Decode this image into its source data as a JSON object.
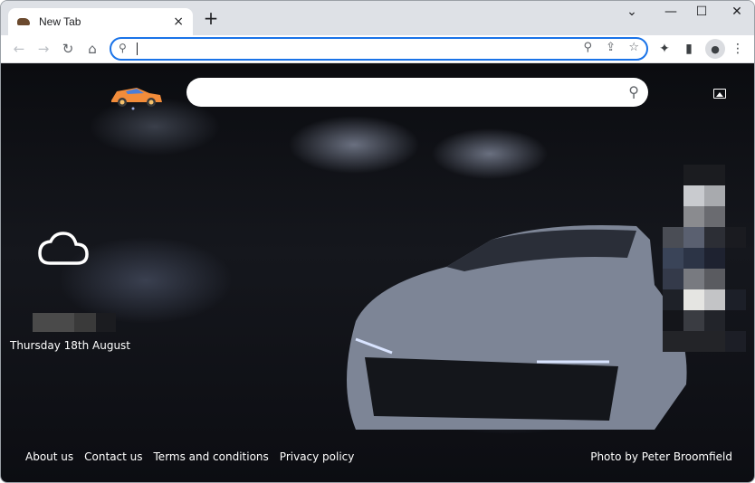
{
  "browser": {
    "tab": {
      "title": "New Tab",
      "close_icon": "×"
    },
    "new_tab_icon": "+",
    "window_controls": {
      "tab_search": "⌄",
      "minimize": "—",
      "maximize": "☐",
      "close": "✕"
    },
    "nav": {
      "back": "←",
      "forward": "→",
      "reload": "↻",
      "home": "⌂"
    },
    "omnibox": {
      "value": "",
      "search_icon": "🔍",
      "location_icon": "⚲",
      "share_icon": "⇪",
      "bookmark_icon": "☆"
    },
    "extensions_icon": "✦",
    "side_panel_icon": "▮",
    "profile_icon": "👤",
    "menu_icon": "⋮"
  },
  "page": {
    "search": {
      "value": "",
      "icon": "⌕"
    },
    "weather": {
      "condition": "cloudy",
      "temperature": ""
    },
    "date": "Thursday 18th August",
    "footer_links": [
      "About us",
      "Contact us",
      "Terms and conditions",
      "Privacy policy"
    ],
    "photo_credit": "Photo by Peter Broomfield"
  }
}
